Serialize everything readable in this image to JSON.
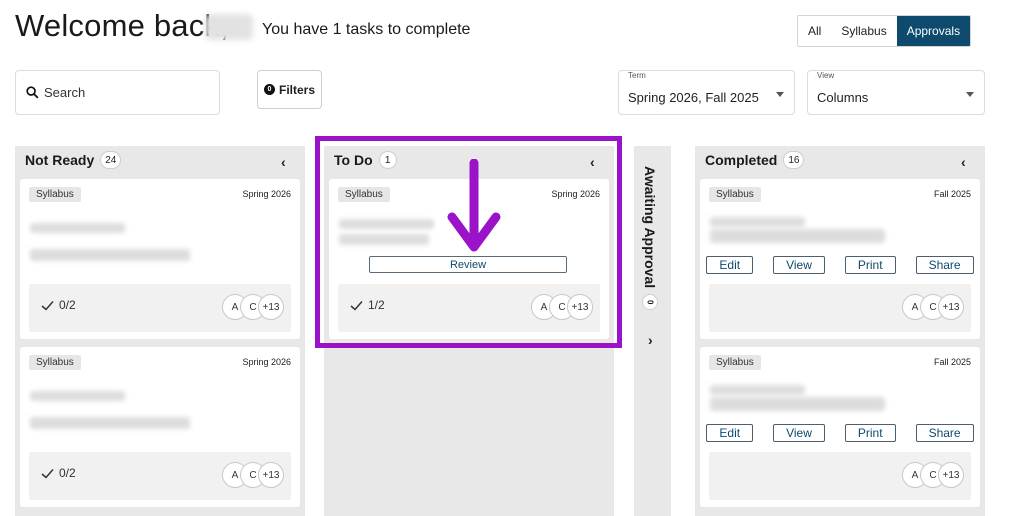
{
  "header": {
    "welcome": "Welcome back,",
    "tasks_message": "You have 1 tasks to complete",
    "segments": [
      "All",
      "Syllabus",
      "Approvals"
    ],
    "active_segment": "Approvals"
  },
  "toolbar": {
    "search_placeholder": "Search",
    "filters_label": "Filters",
    "filters_count": "0",
    "term": {
      "label": "Term",
      "value": "Spring 2026, Fall 2025"
    },
    "view": {
      "label": "View",
      "value": "Columns"
    }
  },
  "columns": {
    "not_ready": {
      "title": "Not Ready",
      "count": "24",
      "cards": [
        {
          "tag": "Syllabus",
          "term": "Spring 2026",
          "progress": "0/2",
          "avatars": [
            "A",
            "C",
            "+13"
          ]
        },
        {
          "tag": "Syllabus",
          "term": "Spring 2026",
          "progress": "0/2",
          "avatars": [
            "A",
            "C",
            "+13"
          ]
        }
      ]
    },
    "todo": {
      "title": "To Do",
      "count": "1",
      "cards": [
        {
          "tag": "Syllabus",
          "term": "Spring 2026",
          "button": "Review",
          "progress": "1/2",
          "avatars": [
            "A",
            "C",
            "+13"
          ]
        }
      ]
    },
    "awaiting": {
      "title": "Awaiting Approval",
      "count": "0"
    },
    "completed": {
      "title": "Completed",
      "count": "16",
      "cards": [
        {
          "tag": "Syllabus",
          "term": "Fall 2025",
          "actions": [
            "Edit",
            "View",
            "Print",
            "Share"
          ],
          "avatars": [
            "A",
            "C",
            "+13"
          ]
        },
        {
          "tag": "Syllabus",
          "term": "Fall 2025",
          "actions": [
            "Edit",
            "View",
            "Print",
            "Share"
          ],
          "avatars": [
            "A",
            "C",
            "+13"
          ]
        }
      ]
    }
  },
  "colors": {
    "accent": "#0d4a6e",
    "highlight": "#9a13c9",
    "column_bg": "#e9e8e8"
  }
}
